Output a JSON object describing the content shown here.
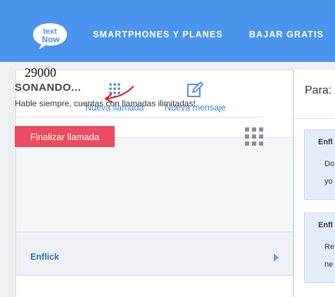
{
  "header": {
    "logo_text_top": "text",
    "logo_text_bottom": "Now",
    "nav": [
      "SMARTPHONES Y PLANES",
      "BAJAR GRATIS"
    ]
  },
  "actions": {
    "new_call": "Nueva llamada",
    "new_message": "Nueva mensaje"
  },
  "call": {
    "number": "29000",
    "status": "SONANDO...",
    "description": "Hable siempre, cuentas con llamadas ilimitadas!",
    "end_button": "Finalizar llamada"
  },
  "contacts": [
    {
      "name": "Enflick"
    }
  ],
  "compose": {
    "to_label": "Para:"
  },
  "messages": [
    {
      "title": "Enfl",
      "line1": "Do",
      "line2": "yo"
    },
    {
      "title": "Enfl",
      "line1": "Re",
      "line2": "ne"
    }
  ],
  "colors": {
    "header_bg": "#4a94ee",
    "link_blue": "#3b86d8",
    "end_call_red": "#ec4c5f",
    "annotation_red": "#e0202a"
  },
  "icons": {
    "new_call": "dialpad-icon",
    "new_message": "compose-icon",
    "keypad": "keypad-grid-icon",
    "contact_chevron": "chevron-right-icon"
  }
}
